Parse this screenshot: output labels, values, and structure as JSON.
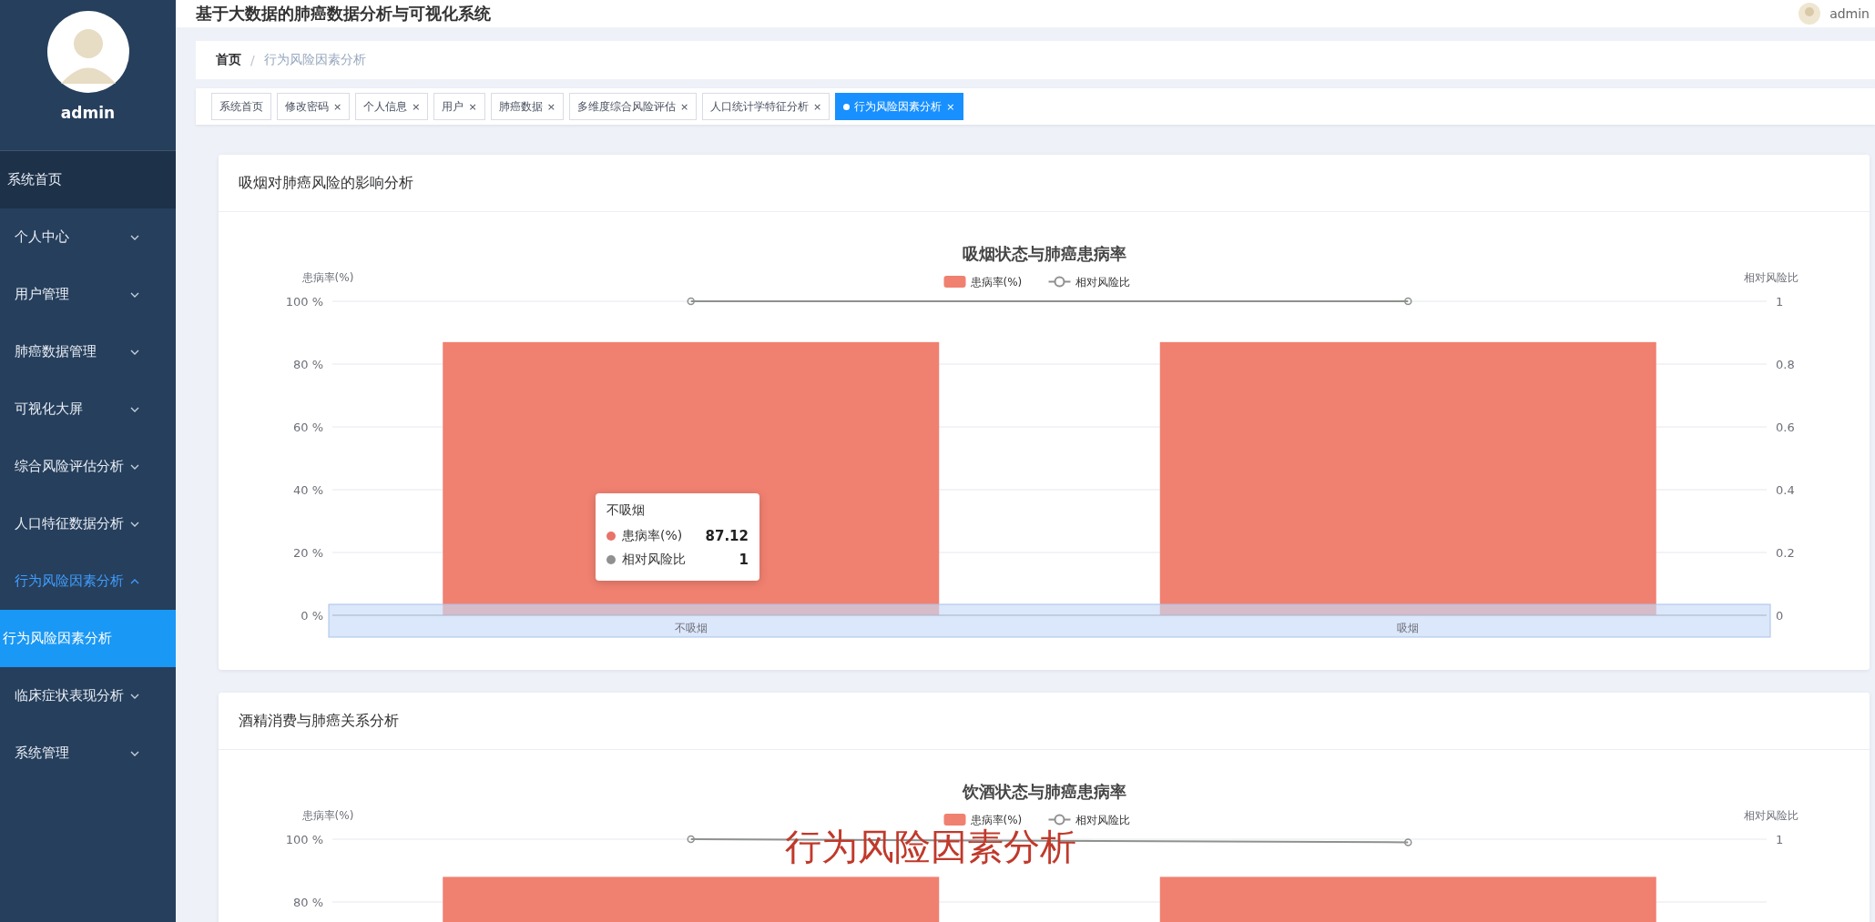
{
  "sidebar": {
    "username": "admin",
    "menu": [
      {
        "label": "系统首页",
        "kind": "link",
        "selected": false
      },
      {
        "label": "个人中心",
        "kind": "group",
        "expanded": false
      },
      {
        "label": "用户管理",
        "kind": "group",
        "expanded": false
      },
      {
        "label": "肺癌数据管理",
        "kind": "group",
        "expanded": false
      },
      {
        "label": "可视化大屏",
        "kind": "group",
        "expanded": false
      },
      {
        "label": "综合风险评估分析",
        "kind": "group",
        "expanded": false
      },
      {
        "label": "人口特征数据分析",
        "kind": "group",
        "expanded": false
      },
      {
        "label": "行为风险因素分析",
        "kind": "group",
        "expanded": true,
        "children": [
          {
            "label": "行为风险因素分析",
            "selected": true
          }
        ]
      },
      {
        "label": "临床症状表现分析",
        "kind": "group",
        "expanded": false
      },
      {
        "label": "系统管理",
        "kind": "group",
        "expanded": false
      }
    ]
  },
  "header": {
    "title": "基于大数据的肺癌数据分析与可视化系统",
    "user": "admin"
  },
  "breadcrumb": {
    "items": [
      "首页",
      "行为风险因素分析"
    ],
    "separator": "/"
  },
  "tabs": [
    {
      "label": "系统首页",
      "selected": false
    },
    {
      "label": "修改密码",
      "close": "×",
      "selected": false
    },
    {
      "label": "个人信息",
      "close": "×",
      "selected": false
    },
    {
      "label": "用户",
      "close": "×",
      "selected": false
    },
    {
      "label": "肺癌数据",
      "close": "×",
      "selected": false
    },
    {
      "label": "多维度综合风险评估",
      "close": "×",
      "selected": false
    },
    {
      "label": "人口统计学特征分析",
      "close": "×",
      "selected": false
    },
    {
      "label": "行为风险因素分析",
      "close": "×",
      "selected": true
    }
  ],
  "cards": [
    {
      "title": "吸烟对肺癌风险的影响分析",
      "chart_data": {
        "type": "bar",
        "title": "吸烟状态与肺癌患病率",
        "ylabel": "患病率(%)",
        "y2label": "相对风险比",
        "categories": [
          "不吸烟",
          "吸烟"
        ],
        "grid": true,
        "legend": true,
        "series": [
          {
            "name": "患病率(%)",
            "type": "bar",
            "color": "#f08070",
            "values": [
              87,
              87
            ]
          },
          {
            "name": "相对风险比",
            "type": "line",
            "axis": "y2",
            "marker": "circle",
            "color": "#8e918e",
            "values": [
              1,
              1
            ]
          }
        ],
        "ylim": [
          0,
          100
        ],
        "y2lim": [
          0,
          1
        ],
        "yticks": [
          {
            "value": 0,
            "label": "0 %"
          },
          {
            "value": 20,
            "label": "20 %"
          },
          {
            "value": 40,
            "label": "40 %"
          },
          {
            "value": 60,
            "label": "60 %"
          },
          {
            "value": 80,
            "label": "80 %"
          },
          {
            "value": 100,
            "label": "100 %"
          }
        ],
        "y2ticks": [
          0,
          0.2,
          0.4,
          0.6,
          0.8,
          1
        ]
      },
      "tooltip": {
        "title": "不吸烟",
        "rows": [
          {
            "name": "患病率(%)",
            "value": "87.12",
            "color": "#e8736a"
          },
          {
            "name": "相对风险比",
            "value": "1",
            "color": "#8e918e"
          }
        ]
      }
    },
    {
      "title": "酒精消费与肺癌关系分析",
      "chart_data": {
        "type": "bar",
        "title": "饮酒状态与肺癌患病率",
        "ylabel": "患病率(%)",
        "y2label": "相对风险比",
        "grid": true,
        "legend": true,
        "series": [
          {
            "name": "患病率(%)",
            "type": "bar",
            "color": "#f08070",
            "values": [
              88,
              88
            ]
          },
          {
            "name": "相对风险比",
            "type": "line",
            "axis": "y2",
            "marker": "circle",
            "color": "#8e918e",
            "values": [
              1,
              0.99
            ]
          }
        ],
        "ylim": [
          0,
          100
        ],
        "y2lim": [
          0,
          1
        ],
        "yticks": [
          {
            "value": 80,
            "label": "80 %"
          },
          {
            "value": 100,
            "label": "100 %"
          }
        ],
        "y2ticks": [
          1
        ]
      }
    }
  ],
  "caption": "行为风险因素分析"
}
